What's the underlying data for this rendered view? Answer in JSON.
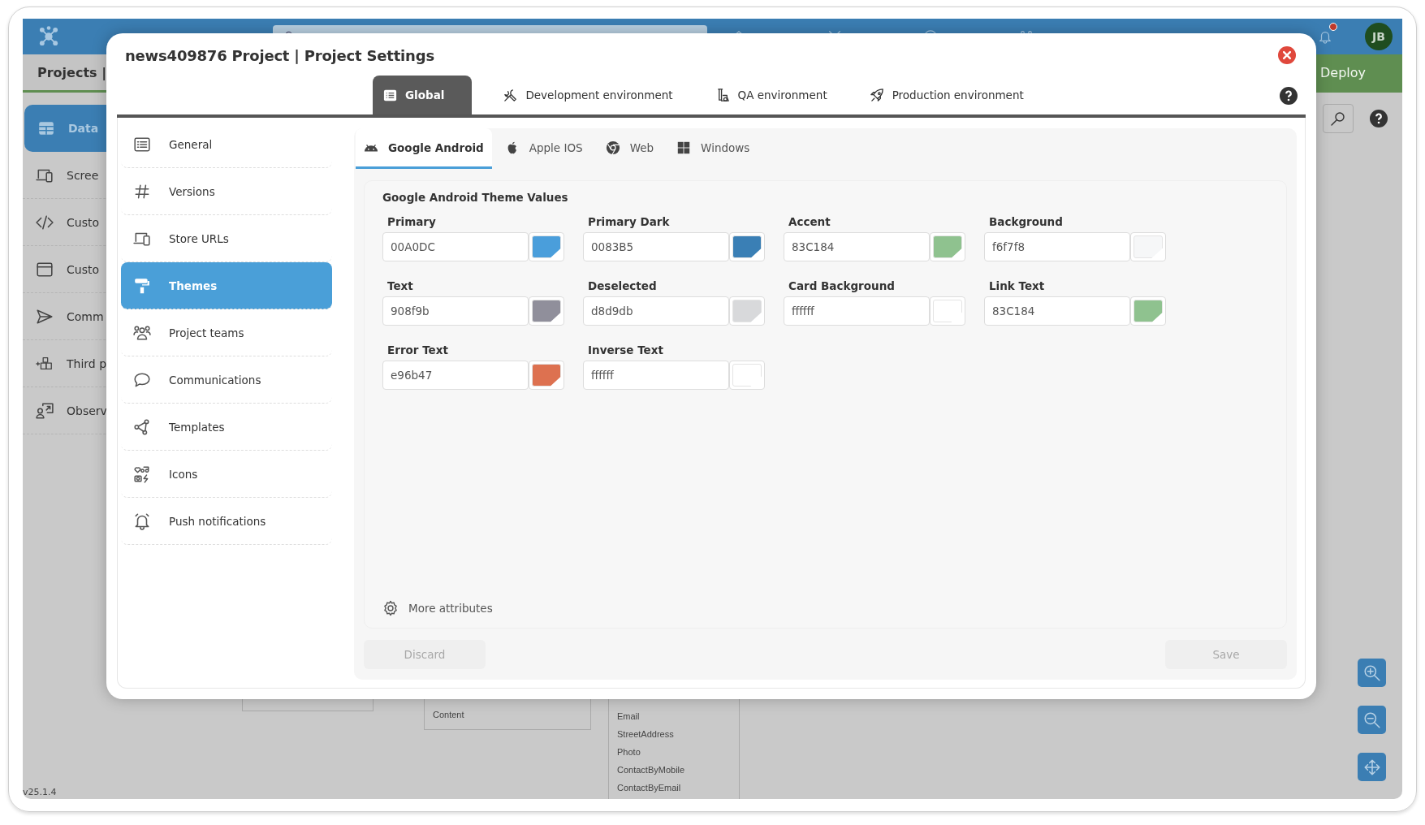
{
  "background_app": {
    "avatar": "JB",
    "breadcrumb": "Projects |",
    "deploy": "Deploy",
    "sidebar": [
      {
        "label": "Data",
        "selected": true
      },
      {
        "label": "Scree",
        "selected": false
      },
      {
        "label": "Custo",
        "selected": false
      },
      {
        "label": "Custo",
        "selected": false
      },
      {
        "label": "Comm",
        "selected": false
      },
      {
        "label": "Third p",
        "selected": false
      },
      {
        "label": "Observ",
        "selected": false
      }
    ],
    "diagram": [
      {
        "fields": [
          "Content"
        ]
      },
      {
        "fields": [
          "Email",
          "StreetAddress",
          "Photo",
          "ContactByMobile",
          "ContactByEmail"
        ]
      }
    ],
    "version": "v25.1.4"
  },
  "dialog": {
    "title": "news409876 Project | Project Settings",
    "env_tabs": [
      {
        "label": "Global",
        "selected": true
      },
      {
        "label": "Development environment",
        "selected": false
      },
      {
        "label": "QA environment",
        "selected": false
      },
      {
        "label": "Production environment",
        "selected": false
      }
    ],
    "menu": [
      {
        "label": "General",
        "selected": false
      },
      {
        "label": "Versions",
        "selected": false
      },
      {
        "label": "Store URLs",
        "selected": false
      },
      {
        "label": "Themes",
        "selected": true
      },
      {
        "label": "Project teams",
        "selected": false
      },
      {
        "label": "Communications",
        "selected": false
      },
      {
        "label": "Templates",
        "selected": false
      },
      {
        "label": "Icons",
        "selected": false
      },
      {
        "label": "Push notifications",
        "selected": false
      }
    ],
    "platform_tabs": [
      {
        "label": "Google Android",
        "selected": true
      },
      {
        "label": "Apple IOS",
        "selected": false
      },
      {
        "label": "Web",
        "selected": false
      },
      {
        "label": "Windows",
        "selected": false
      }
    ],
    "section_title": "Google Android Theme Values",
    "fields": [
      {
        "label": "Primary",
        "value": "00A0DC",
        "color": "#4a9edb"
      },
      {
        "label": "Primary Dark",
        "value": "0083B5",
        "color": "#3a7fb5"
      },
      {
        "label": "Accent",
        "value": "83C184",
        "color": "#8fc28f"
      },
      {
        "label": "Background",
        "value": "f6f7f8",
        "color": "#f6f7f8"
      },
      {
        "label": "Text",
        "value": "908f9b",
        "color": "#908f9b"
      },
      {
        "label": "Deselected",
        "value": "d8d9db",
        "color": "#d8d9db"
      },
      {
        "label": "Card Background",
        "value": "ffffff",
        "color": "#ffffff"
      },
      {
        "label": "Link Text",
        "value": "83C184",
        "color": "#8fc28f"
      },
      {
        "label": "Error Text",
        "value": "e96b47",
        "color": "#dd7150"
      },
      {
        "label": "Inverse Text",
        "value": "ffffff",
        "color": "#ffffff"
      }
    ],
    "more_attributes": "More attributes",
    "buttons": [
      {
        "label": "Discard",
        "disabled": true
      },
      {
        "label": "Save",
        "disabled": true
      }
    ]
  }
}
